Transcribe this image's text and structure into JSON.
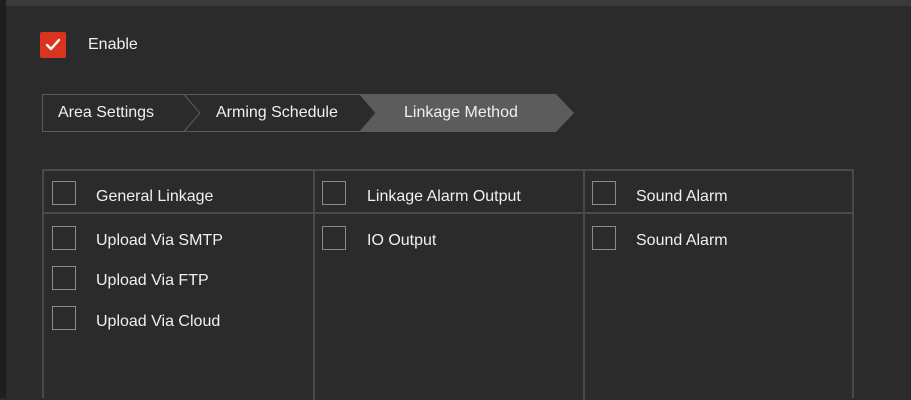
{
  "enable": {
    "label": "Enable",
    "checked": true,
    "accent_color": "#d9341f"
  },
  "tabs": [
    {
      "label": "Area Settings",
      "active": false
    },
    {
      "label": "Arming Schedule",
      "active": false
    },
    {
      "label": "Linkage Method",
      "active": true
    }
  ],
  "linkage": {
    "columns": [
      {
        "header": "General Linkage",
        "items": [
          "Upload Via SMTP",
          "Upload Via FTP",
          "Upload Via Cloud"
        ]
      },
      {
        "header": "Linkage Alarm Output",
        "items": [
          "IO Output"
        ]
      },
      {
        "header": "Sound Alarm",
        "items": [
          "Sound Alarm"
        ]
      }
    ]
  }
}
